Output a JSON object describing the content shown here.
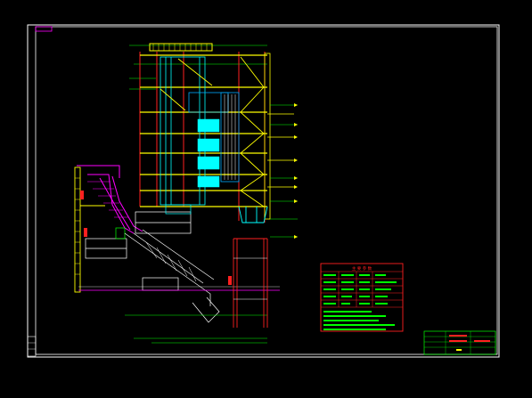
{
  "colors": {
    "background": "#000000",
    "frame": "#ffffff",
    "boiler_structure": "#ffff00",
    "water_wall": "#00ffff",
    "fuel_feed": "#ff00ff",
    "steel_frame": "#ff2020",
    "panels": "#00aaff",
    "piping": "#00ff00"
  },
  "icons": [
    "drawing-frame",
    "boiler-elevation",
    "fuel-chute",
    "grate",
    "flue-stack",
    "tech-spec-table",
    "title-block"
  ],
  "spec_table": {
    "header": "主 要 参 数"
  },
  "title_block": {
    "drawing_title": ""
  }
}
